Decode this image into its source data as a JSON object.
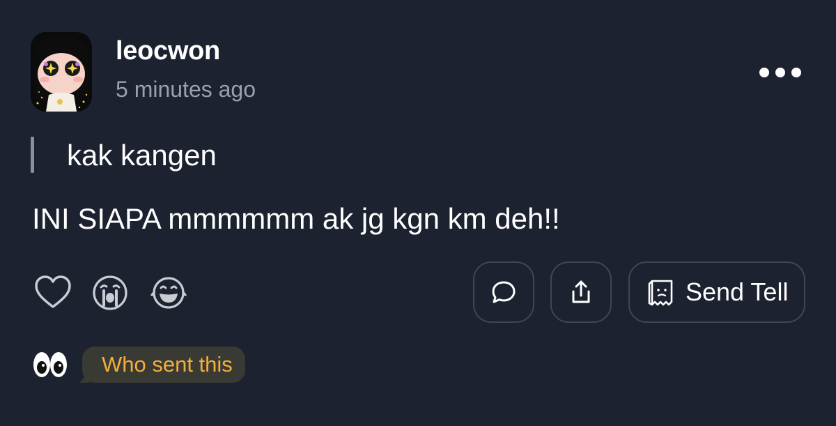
{
  "post": {
    "username": "leocwon",
    "timestamp": "5 minutes ago",
    "quote": "kak kangen",
    "reply": "INI SIAPA mmmmmm ak jg kgn km deh!!"
  },
  "reactions": [
    {
      "icon": "heart-outline-icon"
    },
    {
      "icon": "crying-face-icon"
    },
    {
      "icon": "laughing-face-icon"
    }
  ],
  "actions": {
    "comment_icon": "speech-bubble-icon",
    "share_icon": "share-upload-icon",
    "send_tell_icon": "paper-bag-icon",
    "send_tell_label": "Send Tell"
  },
  "footer": {
    "eyes_icon": "eyes-emoji-icon",
    "who_sent_label": "Who sent this"
  },
  "colors": {
    "background": "#1c2230",
    "button_border": "#3e4659",
    "accent_orange": "#f2ae3e",
    "bubble_bg": "#383a33",
    "muted_text": "#9aa0ad"
  }
}
